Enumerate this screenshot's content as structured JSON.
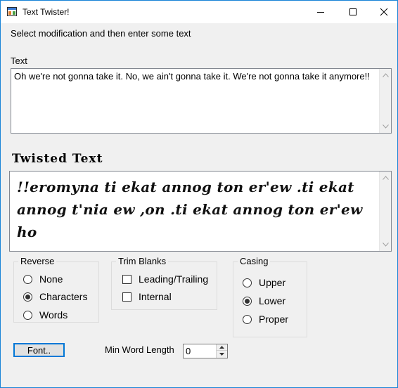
{
  "window": {
    "title": "Text Twister!",
    "accent": "#0078d7"
  },
  "instructions": "Select modification  and then enter some text",
  "input": {
    "label": "Text",
    "value": "Oh we're not gonna take it. No, we ain't gonna take it. We're not gonna take it anymore!!"
  },
  "output": {
    "heading": "Twisted Text",
    "value": "!!eromyna ti ekat annog ton er'ew .ti ekat annog t'nia ew ,on .ti ekat annog ton er'ew ho"
  },
  "reverse": {
    "title": "Reverse",
    "options": [
      {
        "label": "None",
        "selected": false
      },
      {
        "label": "Characters",
        "selected": true
      },
      {
        "label": "Words",
        "selected": false
      }
    ]
  },
  "trim": {
    "title": "Trim Blanks",
    "options": [
      {
        "label": "Leading/Trailing",
        "checked": false
      },
      {
        "label": "Internal",
        "checked": false
      }
    ]
  },
  "casing": {
    "title": "Casing",
    "options": [
      {
        "label": "Upper",
        "selected": false
      },
      {
        "label": "Lower",
        "selected": true
      },
      {
        "label": "Proper",
        "selected": false
      }
    ]
  },
  "font_button": "Font..",
  "min_word_length": {
    "label": "Min Word Length",
    "value": "0"
  }
}
